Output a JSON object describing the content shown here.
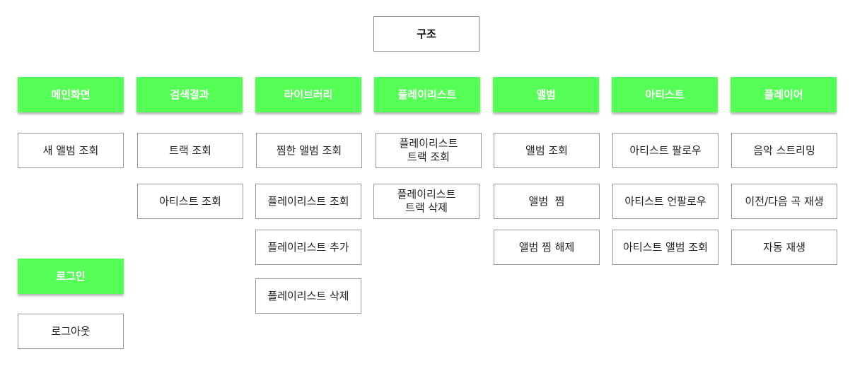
{
  "root": "구조",
  "categories": {
    "main": "메인화면",
    "search": "검색결과",
    "library": "라이브러리",
    "playlist": "플레이리스트",
    "album": "앨범",
    "artist": "아티스트",
    "player": "플레이어",
    "login": "로그인"
  },
  "items": {
    "main": [
      "새 앨범 조회"
    ],
    "search": [
      "트랙 조회",
      "아티스트 조회"
    ],
    "library": [
      "찜한 앨범 조회",
      "플레이리스트 조회",
      "플레이리스트 추가",
      "플레이리스트 삭제"
    ],
    "playlist": [
      "플레이리스트\n트랙 조회",
      "플레이리스트\n트랙 삭제"
    ],
    "album": [
      "앨범 조회",
      "앨범  찜",
      "앨범 찜 해제"
    ],
    "artist": [
      "아티스트 팔로우",
      "아티스트 언팔로우",
      "아티스트 앨범 조회"
    ],
    "player": [
      "음악 스트리밍",
      "이전/다음 곡 재생",
      "자동 재생"
    ],
    "login": [
      "로그아웃"
    ]
  }
}
